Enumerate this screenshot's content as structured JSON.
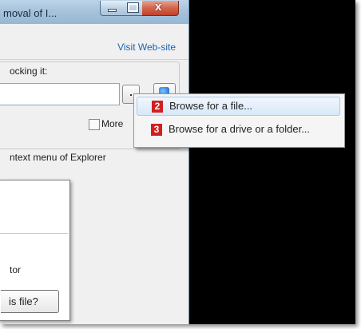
{
  "window": {
    "title": "moval of I...",
    "visit_link": "Visit Web-site",
    "locking_label": "ocking it:",
    "path_value": "",
    "browse_button_label": ".",
    "more_label": "More",
    "more_checked": false,
    "context_label": "ntext menu of Explorer",
    "tor_label": "tor",
    "file_button_label": "is file?"
  },
  "menu": {
    "items": [
      {
        "badge": "2",
        "label": "Browse for a file..."
      },
      {
        "badge": "3",
        "label": "Browse for a drive or a folder..."
      }
    ]
  },
  "colors": {
    "badge": "#d01f1f",
    "link": "#1a63b8",
    "background": "#000000"
  }
}
